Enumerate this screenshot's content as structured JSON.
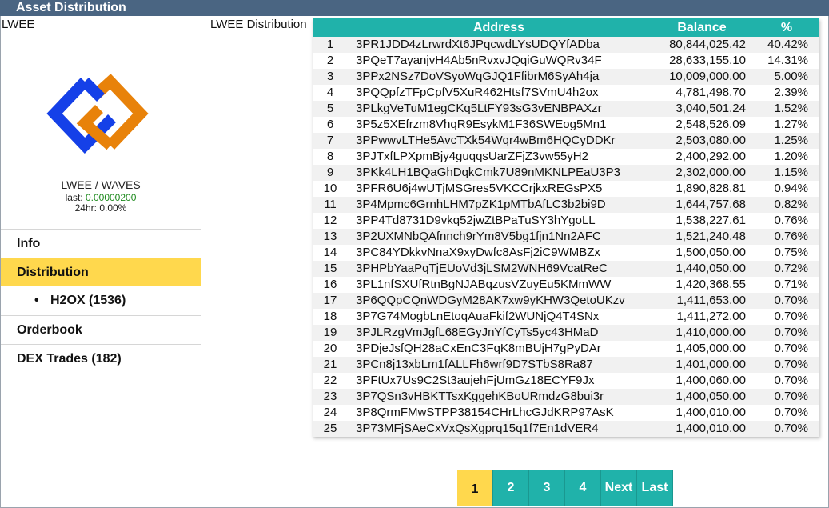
{
  "window": {
    "title": "Asset Distribution"
  },
  "sidebar": {
    "asset_code": "LWEE",
    "pair": "LWEE / WAVES",
    "last_label": "last:",
    "last_value": "0.00000200",
    "change_label": "24hr:",
    "change_value": "0.00%",
    "menu": {
      "info": "Info",
      "distribution": "Distribution",
      "sub_item": "H2OX (1536)",
      "orderbook": "Orderbook",
      "dex_trades": "DEX Trades (182)"
    },
    "logo_colors": {
      "blue": "#1540e8",
      "orange": "#e8820a"
    }
  },
  "main": {
    "section_label": "LWEE Distribution",
    "table": {
      "headers": {
        "address": "Address",
        "balance": "Balance",
        "percent": "%"
      },
      "rows": [
        {
          "n": "1",
          "address": "3PR1JDD4zLrwrdXt6JPqcwdLYsUDQYfADba",
          "balance": "80,844,025.42",
          "pct": "40.42%"
        },
        {
          "n": "2",
          "address": "3PQeT7ayanjvH4Ab5nRvxvJQqiGuWQRv34F",
          "balance": "28,633,155.10",
          "pct": "14.31%"
        },
        {
          "n": "3",
          "address": "3PPx2NSz7DoVSyoWqGJQ1FfibrM6SyAh4ja",
          "balance": "10,009,000.00",
          "pct": "5.00%"
        },
        {
          "n": "4",
          "address": "3PQQpfzTFpCpfV5XuR462Htsf7SVmU4h2ox",
          "balance": "4,781,498.70",
          "pct": "2.39%"
        },
        {
          "n": "5",
          "address": "3PLkgVeTuM1egCKq5LtFY93sG3vENBPAXzr",
          "balance": "3,040,501.24",
          "pct": "1.52%"
        },
        {
          "n": "6",
          "address": "3P5z5XEfrzm8VhqR9EsykM1F36SWEog5Mn1",
          "balance": "2,548,526.09",
          "pct": "1.27%"
        },
        {
          "n": "7",
          "address": "3PPwwvLTHe5AvcTXk54Wqr4wBm6HQCyDDKr",
          "balance": "2,503,080.00",
          "pct": "1.25%"
        },
        {
          "n": "8",
          "address": "3PJTxfLPXpmBjy4guqqsUarZFjZ3vw55yH2",
          "balance": "2,400,292.00",
          "pct": "1.20%"
        },
        {
          "n": "9",
          "address": "3PKk4LH1BQaGhDqkCmk7U89nMKNLPEaU3P3",
          "balance": "2,302,000.00",
          "pct": "1.15%"
        },
        {
          "n": "10",
          "address": "3PFR6U6j4wUTjMSGres5VKCCrjkxREGsPX5",
          "balance": "1,890,828.81",
          "pct": "0.94%"
        },
        {
          "n": "11",
          "address": "3P4Mpmc6GrnhLHM7pZK1pMTbAfLC3b2bi9D",
          "balance": "1,644,757.68",
          "pct": "0.82%"
        },
        {
          "n": "12",
          "address": "3PP4Td8731D9vkq52jwZtBPaTuSY3hYgoLL",
          "balance": "1,538,227.61",
          "pct": "0.76%"
        },
        {
          "n": "13",
          "address": "3P2UXMNbQAfnnch9rYm8V5bg1fjn1Nn2AFC",
          "balance": "1,521,240.48",
          "pct": "0.76%"
        },
        {
          "n": "14",
          "address": "3PC84YDkkvNnaX9xyDwfc8AsFj2iC9WMBZx",
          "balance": "1,500,050.00",
          "pct": "0.75%"
        },
        {
          "n": "15",
          "address": "3PHPbYaaPqTjEUoVd3jLSM2WNH69VcatReC",
          "balance": "1,440,050.00",
          "pct": "0.72%"
        },
        {
          "n": "16",
          "address": "3PL1nfSXUfRtnBgNJABqzusVZuyEu5KMmWW",
          "balance": "1,420,368.55",
          "pct": "0.71%"
        },
        {
          "n": "17",
          "address": "3P6QQpCQnWDGyM28AK7xw9yKHW3QetoUKzv",
          "balance": "1,411,653.00",
          "pct": "0.70%"
        },
        {
          "n": "18",
          "address": "3P7G74MogbLnEtoqAuaFkif2WUNjQ4T4SNx",
          "balance": "1,411,272.00",
          "pct": "0.70%"
        },
        {
          "n": "19",
          "address": "3PJLRzgVmJgfL68EGyJnYfCyTs5yc43HMaD",
          "balance": "1,410,000.00",
          "pct": "0.70%"
        },
        {
          "n": "20",
          "address": "3PDjeJsfQH28aCxEnC3FqK8mBUjH7gPyDAr",
          "balance": "1,405,000.00",
          "pct": "0.70%"
        },
        {
          "n": "21",
          "address": "3PCn8j13xbLm1fALLFh6wrf9D7STbS8Ra87",
          "balance": "1,401,000.00",
          "pct": "0.70%"
        },
        {
          "n": "22",
          "address": "3PFtUx7Us9C2St3aujehFjUmGz18ECYF9Jx",
          "balance": "1,400,060.00",
          "pct": "0.70%"
        },
        {
          "n": "23",
          "address": "3P7QSn3vHBKTTsxKggehKBoURmdzG8bui3r",
          "balance": "1,400,050.00",
          "pct": "0.70%"
        },
        {
          "n": "24",
          "address": "3P8QrmFMwSTPP38154CHrLhcGJdKRP97AsK",
          "balance": "1,400,010.00",
          "pct": "0.70%"
        },
        {
          "n": "25",
          "address": "3P73MFjSAeCxVxQsXgprq15q1f7En1dVER4",
          "balance": "1,400,010.00",
          "pct": "0.70%"
        }
      ]
    },
    "pagination": {
      "pages": [
        "1",
        "2",
        "3",
        "4"
      ],
      "active_page": "1",
      "next": "Next",
      "last": "Last"
    }
  },
  "colors": {
    "title_bar": "#4a6582",
    "accent_teal": "#20b2aa",
    "active_yellow": "#ffd84d"
  }
}
